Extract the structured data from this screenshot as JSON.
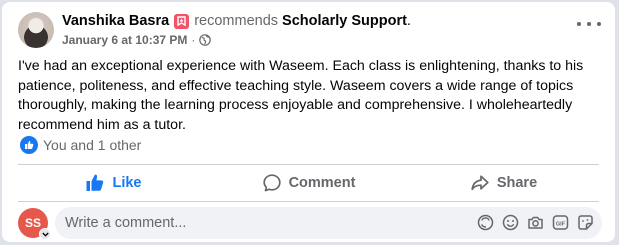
{
  "post": {
    "author": "Vanshika Basra",
    "action_text": "recommends",
    "page_name": "Scholarly Support",
    "period": ".",
    "timestamp": "January 6 at 10:37 PM",
    "separator": "·",
    "audience_icon": "globe-icon",
    "body": "I've had an exceptional experience with Waseem. Each class is enlightening, thanks to his patience, politeness, and effective teaching style. Waseem covers a wide range of topics thoroughly, making the learning process enjoyable and comprehensive. I wholeheartedly recommend him as a tutor."
  },
  "reactions": {
    "summary": "You and 1 other",
    "icon": "like-icon"
  },
  "actions": {
    "like": "Like",
    "comment": "Comment",
    "share": "Share"
  },
  "comment_box": {
    "avatar_initials": "SS",
    "placeholder": "Write a comment...",
    "tools": [
      "avatar-sticker-icon",
      "emoji-icon",
      "camera-icon",
      "gif-icon",
      "sticker-icon"
    ]
  },
  "colors": {
    "accent": "#1877f2",
    "secondary_text": "#65676b",
    "badge": "#f35369",
    "commenter_avatar": "#e7584c"
  }
}
